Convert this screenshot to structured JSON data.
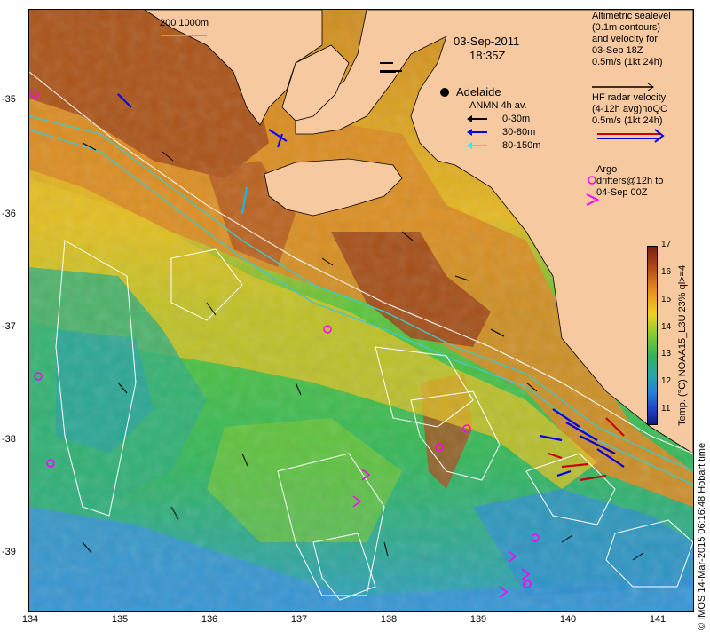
{
  "header": {
    "date": "03-Sep-2011",
    "time": "18:35Z",
    "scale_label": "200  1000m"
  },
  "place": {
    "label": "Adelaide"
  },
  "legend_altimetry": {
    "lines": [
      "Altimetric sealevel",
      "(0.1m contours)",
      "and velocity for",
      "03-Sep 18Z",
      "0.5m/s (1kt 24h)"
    ]
  },
  "legend_radar": {
    "lines": [
      "HF radar velocity",
      "(4-12h avg)noQC",
      "0.5m/s (1kt 24h)"
    ]
  },
  "legend_anmn": {
    "title": "ANMN 4h av.",
    "items": [
      {
        "label": "0-30m",
        "color": "#000000"
      },
      {
        "label": "30-80m",
        "color": "#0000ff"
      },
      {
        "label": "80-150m",
        "color": "#00ffff"
      }
    ]
  },
  "legend_argo": {
    "lines": [
      "Argo",
      "drifters@12h to",
      "04-Sep 00Z"
    ],
    "color": "#ff00ff"
  },
  "colorbar": {
    "ticks": [
      "17",
      "16",
      "15",
      "14",
      "13",
      "12",
      "11"
    ],
    "label": "Temp. (°C) NOAA15_L3U 23% ql>=4"
  },
  "credit": "© IMOS 14-Mar-2015 06:16:48 Hobart time",
  "axes": {
    "lat_ticks": [
      "-35",
      "-36",
      "-37",
      "-38",
      "-39"
    ],
    "lon_ticks": [
      "134",
      "135",
      "136",
      "137",
      "138",
      "139",
      "140",
      "141"
    ]
  },
  "colors": {
    "land": "#f7c9a0",
    "sst_warm": "#a0441a",
    "sst_mid": "#e0a020",
    "sst_green": "#30c030",
    "sst_cool": "#2aa8a8",
    "sst_cold": "#3090e0"
  }
}
